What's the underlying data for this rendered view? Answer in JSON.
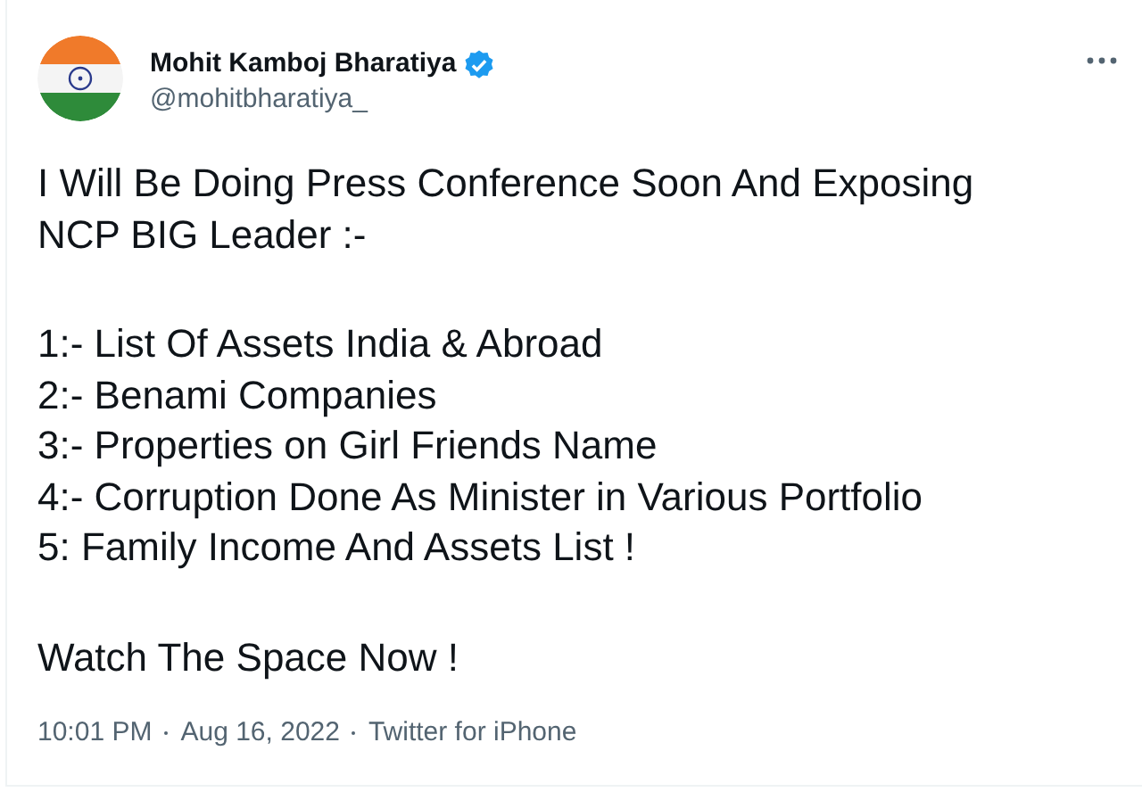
{
  "author": {
    "name": "Mohit Kamboj Bharatiya",
    "verified": true,
    "handle": "@mohitbharatiya_"
  },
  "body": [
    [
      "I Will Be Doing Press Conference Soon And Exposing",
      "NCP BIG Leader :-"
    ],
    [
      "1:- List Of Assets India & Abroad",
      "2:- Benami Companies",
      "3:- Properties on Girl Friends Name",
      "4:- Corruption Done As Minister in Various Portfolio",
      "5: Family Income And Assets List !"
    ],
    [
      "Watch The Space Now !"
    ]
  ],
  "meta": {
    "time": "10:01 PM",
    "date": "Aug 16, 2022",
    "source": "Twitter for iPhone"
  }
}
